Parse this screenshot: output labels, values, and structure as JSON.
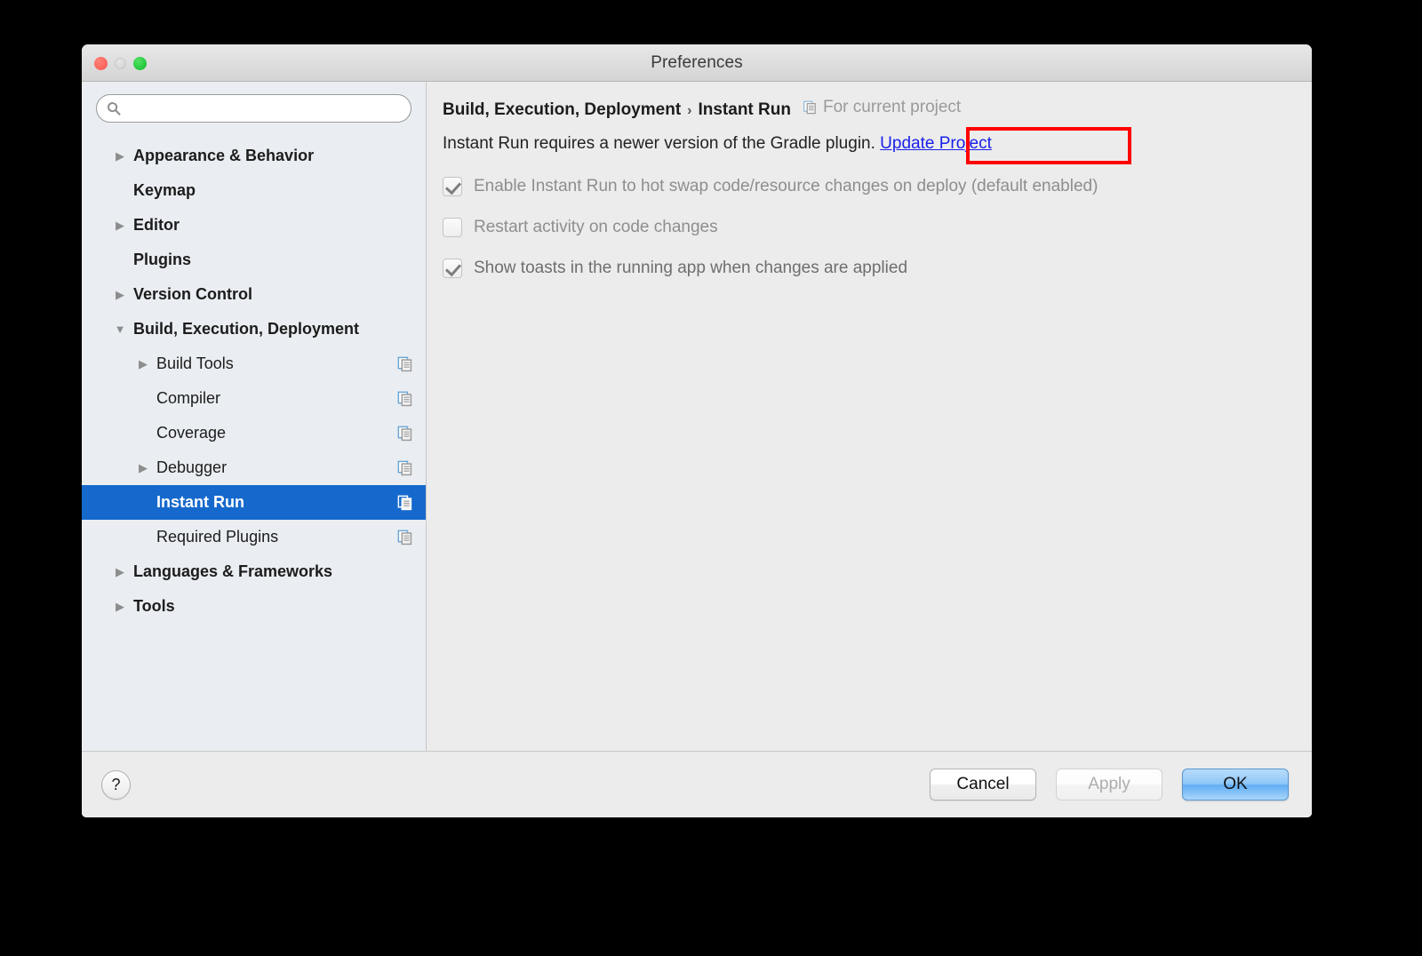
{
  "window": {
    "title": "Preferences",
    "traffic_lights": [
      "close-button",
      "minimize-button",
      "maximize-button"
    ]
  },
  "sidebar": {
    "search": {
      "value": "",
      "placeholder": "",
      "icon": "search-icon"
    },
    "items": [
      {
        "label": "Appearance & Behavior",
        "level": 0,
        "twisty": "collapsed",
        "scope_icon": false,
        "selected": false
      },
      {
        "label": "Keymap",
        "level": 0,
        "twisty": "none",
        "scope_icon": false,
        "selected": false
      },
      {
        "label": "Editor",
        "level": 0,
        "twisty": "collapsed",
        "scope_icon": false,
        "selected": false
      },
      {
        "label": "Plugins",
        "level": 0,
        "twisty": "none",
        "scope_icon": false,
        "selected": false
      },
      {
        "label": "Version Control",
        "level": 0,
        "twisty": "collapsed",
        "scope_icon": false,
        "selected": false
      },
      {
        "label": "Build, Execution, Deployment",
        "level": 0,
        "twisty": "expanded",
        "scope_icon": false,
        "selected": false
      },
      {
        "label": "Build Tools",
        "level": 1,
        "twisty": "collapsed",
        "scope_icon": true,
        "selected": false
      },
      {
        "label": "Compiler",
        "level": 1,
        "twisty": "none",
        "scope_icon": true,
        "selected": false
      },
      {
        "label": "Coverage",
        "level": 1,
        "twisty": "none",
        "scope_icon": true,
        "selected": false
      },
      {
        "label": "Debugger",
        "level": 1,
        "twisty": "collapsed",
        "scope_icon": true,
        "selected": false
      },
      {
        "label": "Instant Run",
        "level": 1,
        "twisty": "none",
        "scope_icon": true,
        "selected": true
      },
      {
        "label": "Required Plugins",
        "level": 1,
        "twisty": "none",
        "scope_icon": true,
        "selected": false
      },
      {
        "label": "Languages & Frameworks",
        "level": 0,
        "twisty": "collapsed",
        "scope_icon": false,
        "selected": false
      },
      {
        "label": "Tools",
        "level": 0,
        "twisty": "collapsed",
        "scope_icon": false,
        "selected": false
      }
    ]
  },
  "panel": {
    "breadcrumb": {
      "parent": "Build, Execution, Deployment",
      "separator": "›",
      "current": "Instant Run",
      "scope_label": "For current project",
      "scope_icon": "project-scope-icon"
    },
    "notice": {
      "text": "Instant Run requires a newer version of the Gradle plugin.",
      "link": "Update Project",
      "highlight_color": "#ff0000",
      "link_color": "#1a20e8"
    },
    "checkboxes": [
      {
        "label": "Enable Instant Run to hot swap code/resource changes on deploy (default enabled)",
        "checked": true,
        "enabled": false
      },
      {
        "label": "Restart activity on code changes",
        "checked": false,
        "enabled": false
      },
      {
        "label": "Show toasts in the running app when changes are applied",
        "checked": true,
        "enabled": true
      }
    ]
  },
  "footer": {
    "help_label": "?",
    "cancel_label": "Cancel",
    "apply_label": "Apply",
    "ok_label": "OK",
    "apply_enabled": false,
    "ok_is_default": true
  },
  "colors": {
    "selection_blue": "#1669cc",
    "sidebar_bg": "#eaeef2",
    "panel_bg": "#ececec",
    "accent_red": "#ff0000"
  }
}
